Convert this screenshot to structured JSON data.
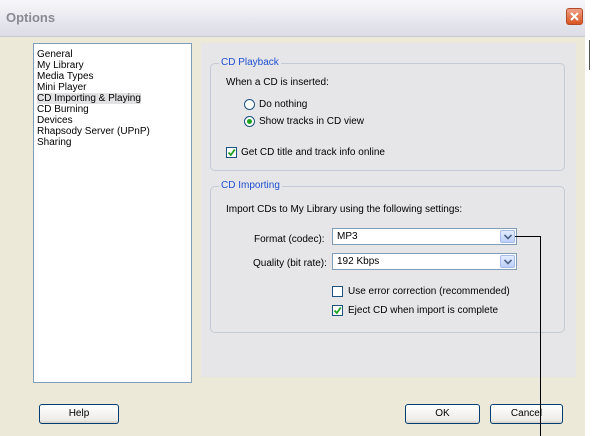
{
  "window": {
    "title": "Options"
  },
  "categories": [
    {
      "label": "General"
    },
    {
      "label": "My Library"
    },
    {
      "label": "Media Types"
    },
    {
      "label": "Mini Player"
    },
    {
      "label": "CD Importing & Playing"
    },
    {
      "label": "CD Burning"
    },
    {
      "label": "Devices"
    },
    {
      "label": "Rhapsody Server (UPnP)"
    },
    {
      "label": "Sharing"
    }
  ],
  "playback": {
    "legend": "CD Playback",
    "prompt": "When a CD is inserted:",
    "options": [
      {
        "label": "Do nothing",
        "selected": false
      },
      {
        "label": "Show tracks in CD view",
        "selected": true
      }
    ],
    "get_info_label": "Get CD title and track info online",
    "get_info_checked": true
  },
  "importing": {
    "legend": "CD Importing",
    "intro": "Import CDs to My Library using the following settings:",
    "format_label": "Format (codec):",
    "format_value": "MP3",
    "quality_label": "Quality (bit rate):",
    "quality_value": "192 Kbps",
    "error_correction_label": "Use error correction (recommended)",
    "error_correction_checked": false,
    "eject_label": "Eject CD when import is complete",
    "eject_checked": true
  },
  "buttons": {
    "help": "Help",
    "ok": "OK",
    "cancel": "Cancel"
  },
  "colors": {
    "accent": "#1f4fd1",
    "dialog_bg": "#ece9d8",
    "check_green": "#21a121"
  }
}
